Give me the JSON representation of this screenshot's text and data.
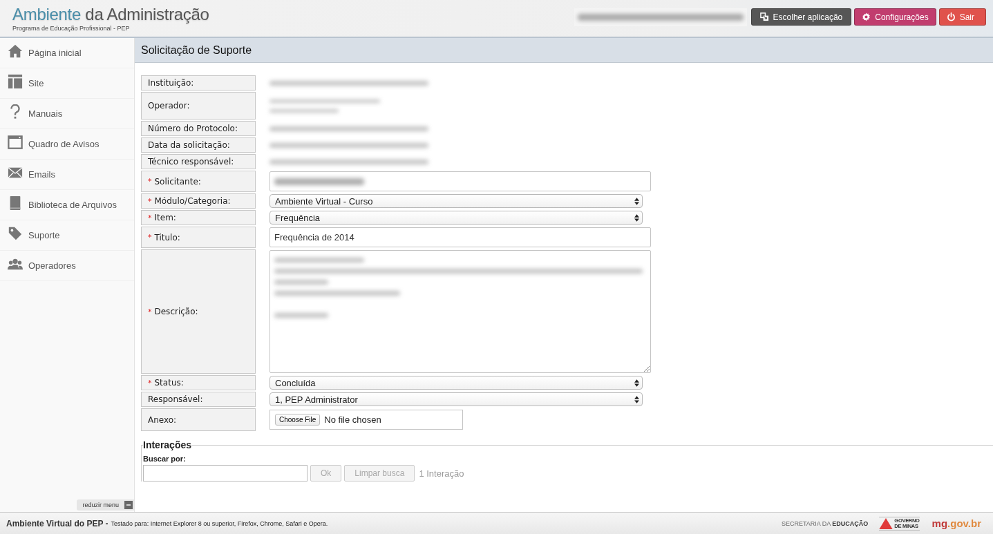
{
  "header": {
    "title_highlight": "Ambiente",
    "title_rest": "da Administração",
    "subtitle": "Programa de Educação Profissional - PEP",
    "user": {
      "kind": "redacted"
    },
    "buttons": [
      {
        "kind": "switch",
        "label": "Escolher aplicação"
      },
      {
        "kind": "settings",
        "label": "Configurações"
      },
      {
        "kind": "logout",
        "label": "Sair"
      }
    ]
  },
  "sidebar": {
    "items": [
      {
        "label": "Página inicial"
      },
      {
        "label": "Site"
      },
      {
        "label": "Manuais"
      },
      {
        "label": "Quadro de Avisos"
      },
      {
        "label": "Emails"
      },
      {
        "label": "Biblioteca de Arquivos"
      },
      {
        "label": "Suporte"
      },
      {
        "label": "Operadores"
      }
    ],
    "collapse_label": "reduzir menu"
  },
  "page_title": "Solicitação de Suporte",
  "form": {
    "rows": [
      {
        "label": "Instituição:",
        "kind": "redacted"
      },
      {
        "label": "Operador:",
        "kind": "redacted_two_line"
      },
      {
        "label": "Número do Protocolo:",
        "kind": "redacted"
      },
      {
        "label": "Data da solicitação:",
        "kind": "redacted"
      },
      {
        "label": "Técnico responsável:",
        "kind": "redacted"
      },
      {
        "label": "Solicitante:",
        "required_mark": "*",
        "kind": "input_redacted"
      },
      {
        "label": "Módulo/Categoria:",
        "required_mark": "*",
        "kind": "select",
        "value": "Ambiente Virtual - Curso"
      },
      {
        "label": "Item:",
        "required_mark": "*",
        "kind": "select",
        "value": "Frequência"
      },
      {
        "label": "Titulo:",
        "required_mark": "*",
        "kind": "input",
        "value": "Frequência de 2014"
      },
      {
        "label": "Descrição:",
        "required_mark": "*",
        "kind": "textarea_redacted"
      },
      {
        "label": "Status:",
        "required_mark": "*",
        "kind": "select",
        "value": "Concluída"
      },
      {
        "label": "Responsável:",
        "kind": "select",
        "value": "1, PEP Administrator"
      },
      {
        "label": "Anexo:",
        "kind": "file",
        "button_label": "Choose File",
        "value": "No file chosen"
      }
    ]
  },
  "interactions": {
    "title": "Interações",
    "search_label": "Buscar por:",
    "buttons": [
      {
        "label": "Ok",
        "disabled": true
      },
      {
        "label": "Limpar busca",
        "disabled": true
      }
    ],
    "count_text": "1 Interação"
  },
  "footer": {
    "title": "Ambiente Virtual do PEP -",
    "note": "Testado para: Internet Explorer 8 ou superior, Firefox, Chrome, Safari e Opera.",
    "secretaria_light": "SECRETARIA DA",
    "secretaria_bold": "EDUCAÇÃO",
    "governo": [
      "GOVERNO",
      "DE MINAS"
    ],
    "site_logo": [
      "mg",
      ".gov.br"
    ]
  }
}
